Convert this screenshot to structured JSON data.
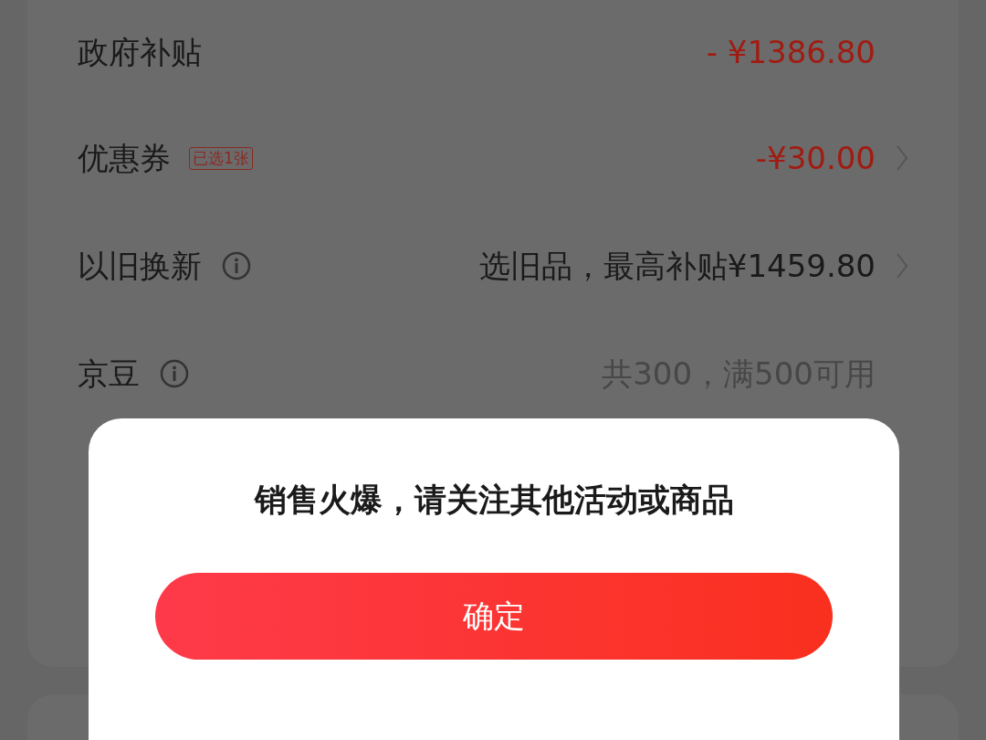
{
  "rows": [
    {
      "label": "政府补贴",
      "info": false,
      "value": "- ¥1386.80",
      "kind": "discount",
      "chevron": false
    },
    {
      "label": "优惠券",
      "info": false,
      "badge": "已选1张",
      "value": "-¥30.00",
      "kind": "discount",
      "chevron": true
    },
    {
      "label": "以旧换新",
      "info": true,
      "value": "选旧品，最高补贴¥1459.80",
      "kind": "normal",
      "chevron": true
    },
    {
      "label": "京豆",
      "info": true,
      "value": "共300，满500可用",
      "kind": "muted",
      "chevron": false
    }
  ],
  "dialog": {
    "message": "销售火爆，请关注其他活动或商品",
    "button": "确定"
  }
}
